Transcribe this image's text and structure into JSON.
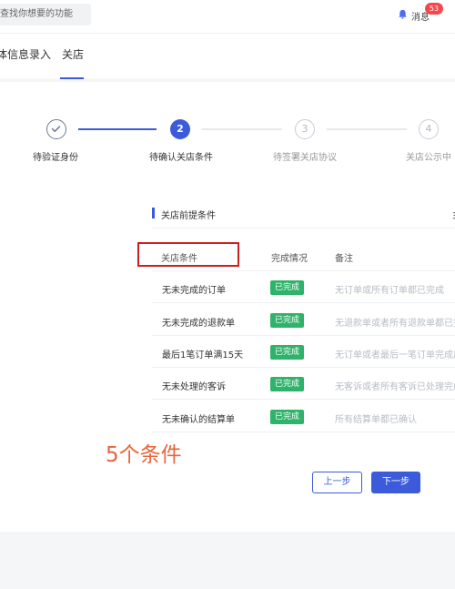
{
  "header": {
    "search_placeholder": "查找你想要的功能",
    "messages_label": "消息",
    "messages_count": "53"
  },
  "tabs": [
    {
      "label": "体信息录入"
    },
    {
      "label": "关店",
      "active": true
    }
  ],
  "steps": [
    {
      "number": "",
      "label": "待验证身份",
      "state": "done"
    },
    {
      "number": "2",
      "label": "待确认关店条件",
      "state": "current"
    },
    {
      "number": "3",
      "label": "待签署关店协议",
      "state": "pending"
    },
    {
      "number": "4",
      "label": "关店公示中",
      "state": "pending"
    }
  ],
  "section": {
    "title": "关店前提条件",
    "right_text": "彡"
  },
  "table": {
    "columns": [
      "关店条件",
      "完成情况",
      "备注"
    ],
    "rows": [
      {
        "condition": "无未完成的订单",
        "status": "已完成",
        "note": "无订单或所有订单都已完成"
      },
      {
        "condition": "无未完成的退款单",
        "status": "已完成",
        "note": "无退款单或者所有退款单都已完"
      },
      {
        "condition": "最后1笔订单满15天",
        "status": "已完成",
        "note": "无订单或者最后一笔订单完成后"
      },
      {
        "condition": "无未处理的客诉",
        "status": "已完成",
        "note": "无客诉或者所有客诉已处理完成"
      },
      {
        "condition": "无未确认的结算单",
        "status": "已完成",
        "note": "所有结算单都已确认"
      }
    ]
  },
  "annotation": "5个条件",
  "buttons": {
    "prev": "上一步",
    "next": "下一步"
  },
  "colors": {
    "primary": "#3b5bdb",
    "success": "#2fb36a",
    "annotation": "#e8643c",
    "highlight": "#c8211f",
    "badge": "#f5484c"
  }
}
